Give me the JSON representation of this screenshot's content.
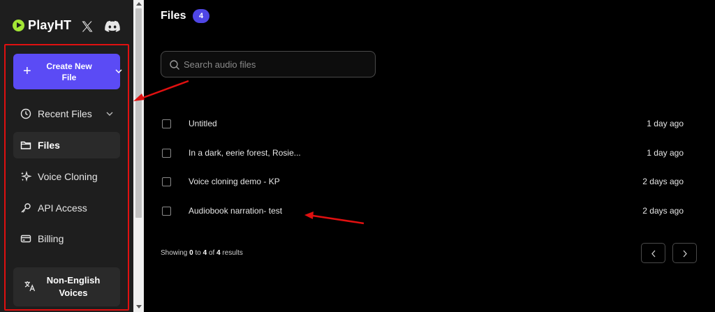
{
  "brand": {
    "name": "PlayHT"
  },
  "sidebar": {
    "create_button": {
      "label": "Create New File"
    },
    "items": [
      {
        "label": "Recent Files",
        "icon": "clock-icon"
      },
      {
        "label": "Files",
        "icon": "folder-icon",
        "active": true
      },
      {
        "label": "Voice Cloning",
        "icon": "sparkles-icon"
      },
      {
        "label": "API Access",
        "icon": "key-icon"
      },
      {
        "label": "Billing",
        "icon": "credit-card-icon"
      }
    ],
    "non_english": {
      "label": "Non-English Voices",
      "icon": "translate-icon"
    }
  },
  "main": {
    "title": "Files",
    "count": "4",
    "search_placeholder": "Search audio files",
    "files": [
      {
        "name": "Untitled",
        "time": "1 day ago"
      },
      {
        "name": "In a dark, eerie forest, Rosie...",
        "time": "1 day ago"
      },
      {
        "name": "Voice cloning demo - KP",
        "time": "2 days ago"
      },
      {
        "name": "Audiobook narration- test",
        "time": "2 days ago"
      }
    ],
    "results": {
      "prefix": "Showing",
      "from": "0",
      "to_word": "to",
      "to": "4",
      "of_word": "of",
      "total": "4",
      "suffix": "results"
    }
  },
  "colors": {
    "accent": "#5b4bf5",
    "badge": "#4f46e5",
    "logo": "#a3e635",
    "annotation": "#e01010",
    "sidebar_bg": "#1e1e1e",
    "main_bg": "#000000"
  }
}
